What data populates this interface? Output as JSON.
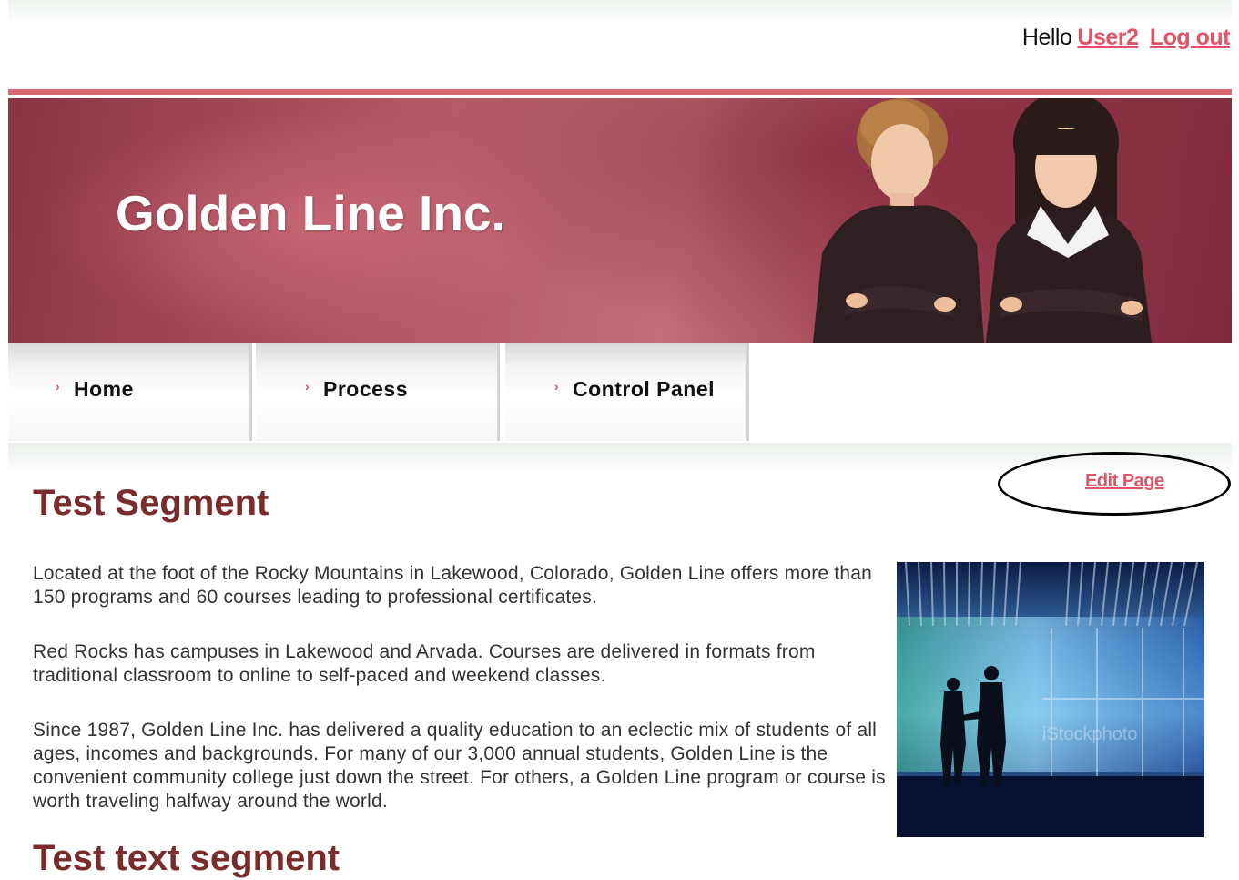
{
  "userbar": {
    "greeting": "Hello",
    "username": "User2",
    "logout_label": "Log out"
  },
  "banner": {
    "title": "Golden Line Inc."
  },
  "nav": {
    "tabs": [
      {
        "label": "Home",
        "icon": "chevron-right-icon"
      },
      {
        "label": "Process",
        "icon": "chevron-right-icon"
      },
      {
        "label": "Control Panel",
        "icon": "chevron-right-icon"
      }
    ]
  },
  "edit_page_label": "Edit Page",
  "content": {
    "heading1": "Test Segment",
    "paragraphs": [
      "Located at the foot of the Rocky Mountains in Lakewood, Colorado, Golden Line offers more than 150 programs and 60 courses leading to professional certificates.",
      "Red Rocks has campuses in Lakewood and Arvada. Courses are delivered in formats from traditional classroom to online to self-paced and weekend classes.",
      "Since 1987, Golden Line Inc. has delivered a quality education to an eclectic mix of students of all ages, incomes and backgrounds. For many of our 3,000 annual students, Golden Line is the convenient community college just down the street. For others, a Golden Line program or course is worth traveling halfway around the world."
    ],
    "heading2": "Test text segment",
    "photo_watermark": "iStockphoto"
  },
  "colors": {
    "link": "#dd5566",
    "heading": "#7a2b2b",
    "banner": "#b15462",
    "header_line": "#d96a72"
  }
}
